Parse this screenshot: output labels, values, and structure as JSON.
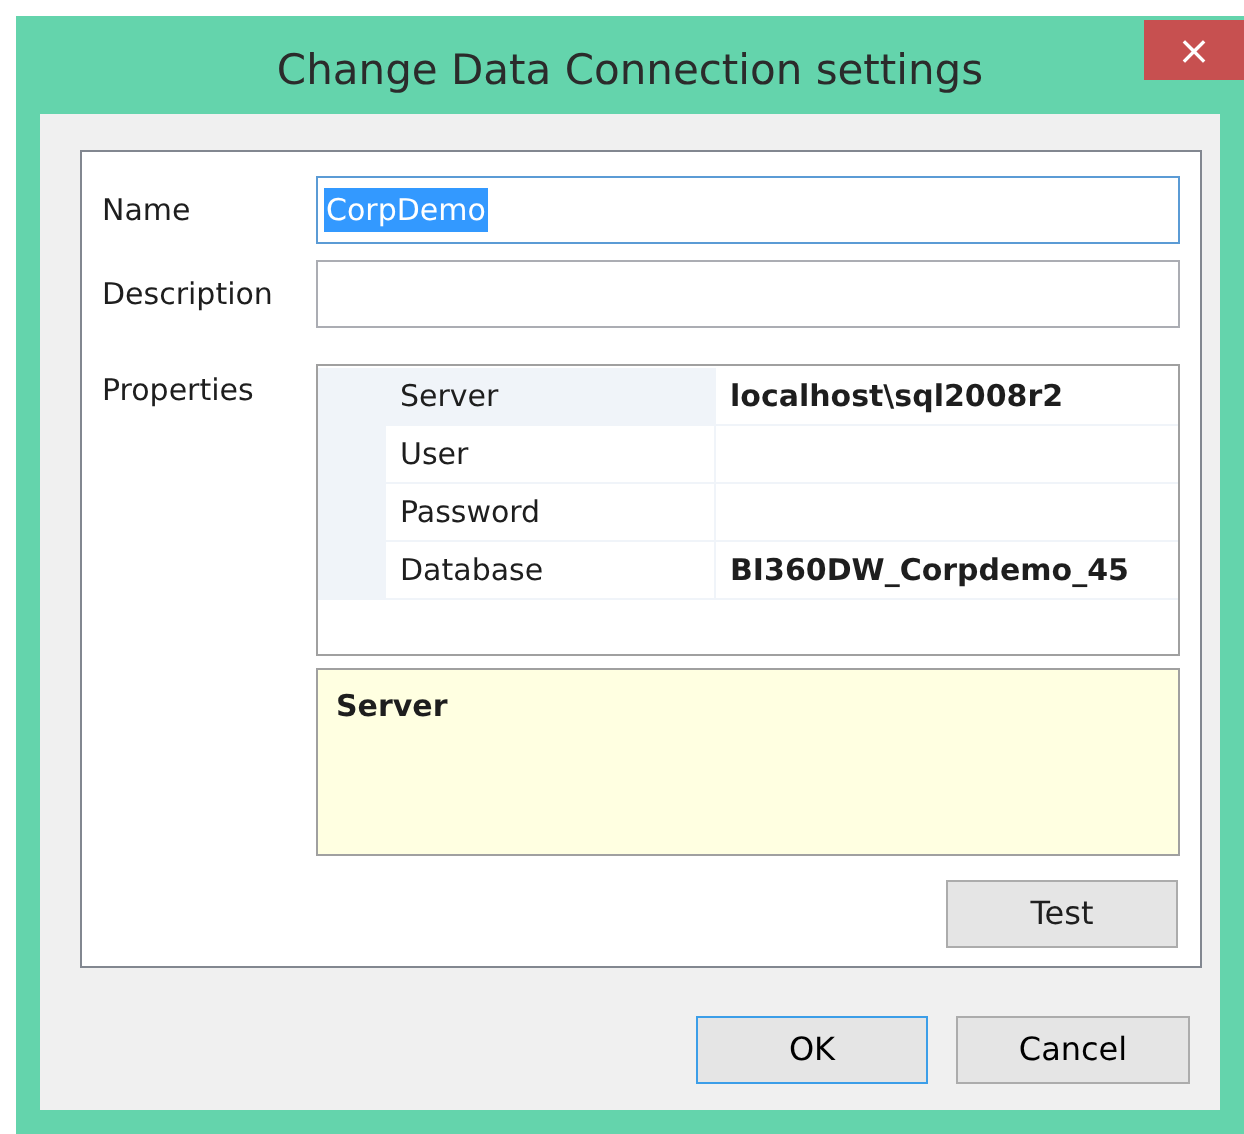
{
  "window": {
    "title": "Change Data Connection settings",
    "close": "×"
  },
  "name": {
    "label": "Name",
    "value": "CorpDemo",
    "text_selected": true
  },
  "description": {
    "label": "Description"
  },
  "properties": {
    "label": "Properties",
    "rows": [
      {
        "name": "Server",
        "value": "localhost\\sql2008r2",
        "selected": true
      },
      {
        "name": "User",
        "selected": false
      },
      {
        "name": "Password",
        "selected": false
      },
      {
        "name": "Database",
        "value": "BI360DW_Corpdemo_45",
        "selected": false
      }
    ],
    "help_title": "Server"
  },
  "buttons": {
    "test": "Test",
    "ok": "OK",
    "cancel": "Cancel"
  }
}
